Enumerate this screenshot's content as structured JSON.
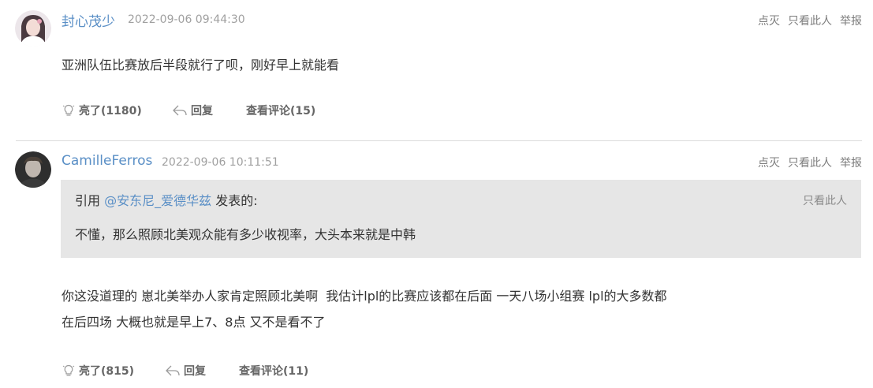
{
  "posts": [
    {
      "username": "封心茂少",
      "timestamp": "2022-09-06 09:44:30",
      "ops": [
        "点灭",
        "只看此人",
        "举报"
      ],
      "lines": [
        "亚洲队伍比赛放后半段就行了呗，刚好早上就能看"
      ],
      "like_label": "亮了(1180)",
      "reply_label": "回复",
      "comments_label": "查看评论(15)"
    },
    {
      "username": "CamilleFerros",
      "timestamp": "2022-09-06 10:11:51",
      "ops": [
        "点灭",
        "只看此人",
        "举报"
      ],
      "quote": {
        "prefix": "引用 ",
        "user": "@安东尼_爱德华兹",
        "suffix": " 发表的:",
        "only_this": "只看此人",
        "text": "不懂，那么照顾北美观众能有多少收视率，大头本来就是中韩"
      },
      "lines": [
        "你这没道理的 崽北美举办人家肯定照顾北美啊  我估计lpl的比赛应该都在后面 一天八场小组赛 lpl的大多数都",
        "在后四场 大概也就是早上7、8点 又不是看不了"
      ],
      "like_label": "亮了(815)",
      "reply_label": "回复",
      "comments_label": "查看评论(11)"
    }
  ],
  "colors": {
    "link": "#5a8fc6",
    "text": "#333333",
    "muted": "#a0a0a0",
    "quote_bg": "#e6e6e6",
    "divider": "#dcdcdc"
  },
  "icons": [
    "lightbulb-icon",
    "reply-arrow-icon"
  ]
}
